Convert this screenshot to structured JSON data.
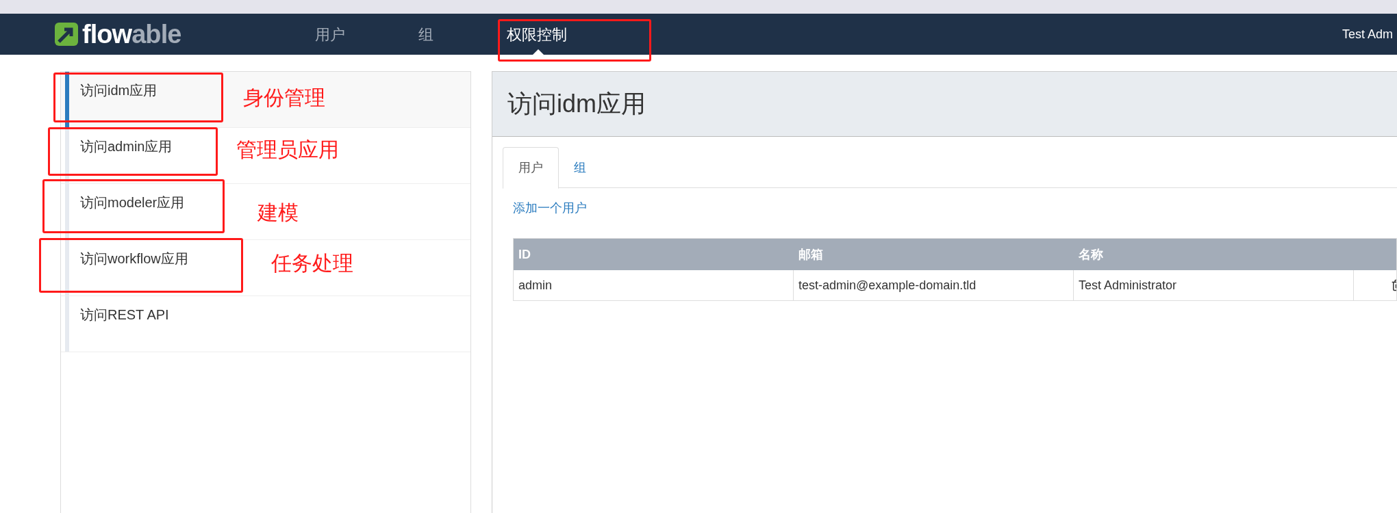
{
  "navbar": {
    "logo": {
      "part_1": "flow",
      "part_2": "able"
    },
    "items": [
      {
        "label": "用户",
        "selected": false
      },
      {
        "label": "组",
        "selected": false
      },
      {
        "label": "权限控制",
        "selected": true
      }
    ],
    "user": "Test Adm"
  },
  "sidebar": {
    "items": [
      {
        "label": "访问idm应用",
        "selected": true
      },
      {
        "label": "访问admin应用",
        "selected": false
      },
      {
        "label": "访问modeler应用",
        "selected": false
      },
      {
        "label": "访问workflow应用",
        "selected": false
      },
      {
        "label": "访问REST API",
        "selected": false
      }
    ]
  },
  "main": {
    "title": "访问idm应用",
    "tabs": [
      {
        "label": "用户",
        "selected": true
      },
      {
        "label": "组",
        "selected": false
      }
    ],
    "add_link": "添加一个用户",
    "table": {
      "columns": [
        "ID",
        "邮箱",
        "名称"
      ],
      "rows": [
        [
          "admin",
          "test-admin@example-domain.tld",
          "Test Administrator"
        ]
      ]
    }
  },
  "annotations": [
    {
      "label": "身份管理"
    },
    {
      "label": "管理员应用"
    },
    {
      "label": "建模"
    },
    {
      "label": "任务处理"
    }
  ]
}
